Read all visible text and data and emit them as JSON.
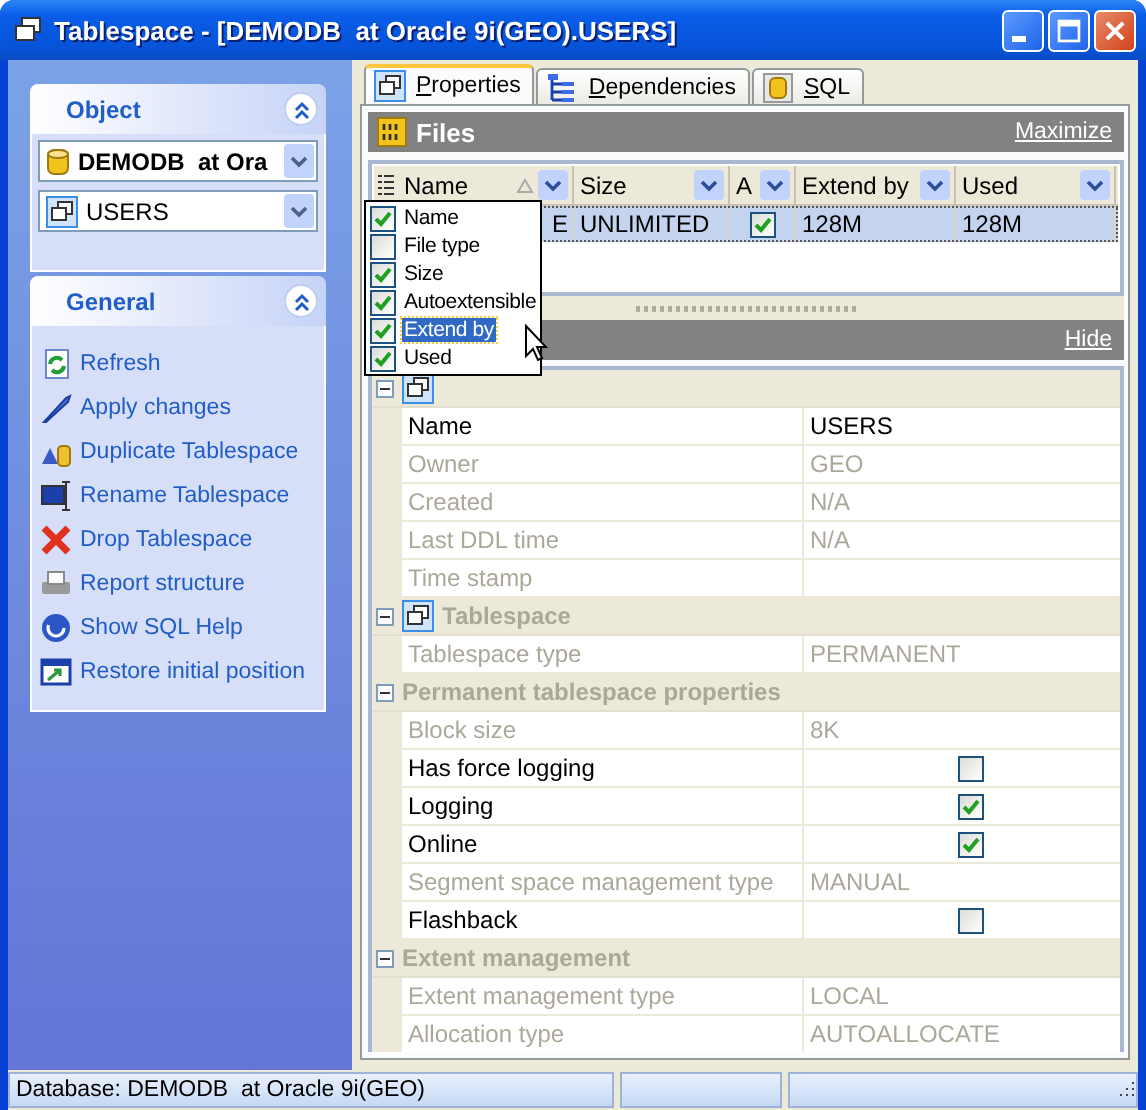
{
  "window": {
    "title": "Tablespace - [DEMODB  at Oracle 9i(GEO).USERS]"
  },
  "object_panel": {
    "title": "Object",
    "expanded": true,
    "database_combo": "DEMODB  at Ora",
    "object_combo": "USERS"
  },
  "general_panel": {
    "title": "General",
    "expanded": true,
    "items": [
      {
        "label": "Refresh"
      },
      {
        "label": "Apply changes"
      },
      {
        "label": "Duplicate Tablespace"
      },
      {
        "label": "Rename Tablespace"
      },
      {
        "label": "Drop Tablespace"
      },
      {
        "label": "Report structure"
      },
      {
        "label": "Show SQL Help"
      },
      {
        "label": "Restore initial position"
      }
    ]
  },
  "tabs": [
    {
      "label": "Properties",
      "selected": true
    },
    {
      "label": "Dependencies",
      "selected": false
    },
    {
      "label": "SQL",
      "selected": false
    }
  ],
  "files": {
    "title": "Files",
    "maximize_link": "Maximize",
    "columns": [
      {
        "label": "Name",
        "sorted": true
      },
      {
        "label": "Size",
        "sorted": false
      },
      {
        "label": "A",
        "sorted": false
      },
      {
        "label": "Extend by",
        "sorted": false
      },
      {
        "label": "Used",
        "sorted": false
      }
    ],
    "rows": [
      {
        "name": "E",
        "size": "UNLIMITED",
        "autoextensible": true,
        "extend_by": "128M",
        "used": "128M",
        "selected": true
      }
    ]
  },
  "column_menu": {
    "items": [
      {
        "label": "Name",
        "checked": true,
        "selected": false
      },
      {
        "label": "File type",
        "checked": false,
        "selected": false
      },
      {
        "label": "Size",
        "checked": true,
        "selected": false
      },
      {
        "label": "Autoextensible",
        "checked": true,
        "selected": false
      },
      {
        "label": "Extend by",
        "checked": true,
        "selected": true
      },
      {
        "label": "Used",
        "checked": true,
        "selected": false
      }
    ]
  },
  "properties": {
    "hide_link": "Hide",
    "groups": [
      {
        "expanded": true,
        "icon": true,
        "rows": [
          {
            "label": "Name",
            "kind": "text",
            "value": "USERS",
            "disabled": false
          },
          {
            "label": "Owner",
            "kind": "text",
            "value": "GEO",
            "disabled": true
          },
          {
            "label": "Created",
            "kind": "text",
            "value": "N/A",
            "disabled": true
          },
          {
            "label": "Last DDL time",
            "kind": "text",
            "value": "N/A",
            "disabled": true
          },
          {
            "label": "Time stamp",
            "kind": "text",
            "disabled": true
          }
        ]
      },
      {
        "title": "Tablespace",
        "expanded": true,
        "icon": true,
        "rows": [
          {
            "label": "Tablespace type",
            "kind": "text",
            "value": "PERMANENT",
            "disabled": true
          }
        ]
      },
      {
        "title": "Permanent tablespace properties",
        "expanded": true,
        "icon": false,
        "rows": [
          {
            "label": "Block size",
            "kind": "text",
            "value": "8K",
            "disabled": true
          },
          {
            "label": "Has force logging",
            "kind": "check",
            "checked": false,
            "disabled": false
          },
          {
            "label": "Logging",
            "kind": "check",
            "checked": true,
            "disabled": false
          },
          {
            "label": "Online",
            "kind": "check",
            "checked": true,
            "disabled": false
          },
          {
            "label": "Segment space management type",
            "kind": "text",
            "value": "MANUAL",
            "disabled": true
          },
          {
            "label": "Flashback",
            "kind": "check",
            "checked": false,
            "disabled": false
          }
        ]
      },
      {
        "title": "Extent management",
        "expanded": true,
        "icon": false,
        "rows": [
          {
            "label": "Extent management type",
            "kind": "text",
            "value": "LOCAL",
            "disabled": true
          },
          {
            "label": "Allocation type",
            "kind": "text",
            "value": "AUTOALLOCATE",
            "disabled": true
          }
        ]
      }
    ]
  },
  "status_bar": {
    "panes": [
      "Database: DEMODB  at Oracle 9i(GEO)"
    ]
  }
}
